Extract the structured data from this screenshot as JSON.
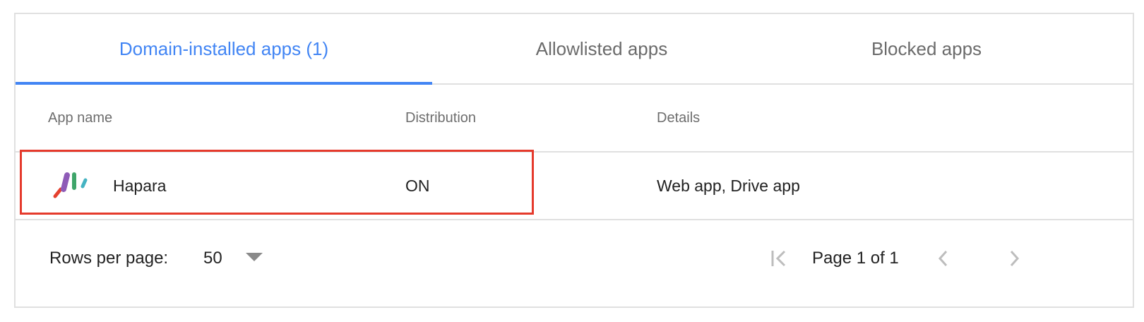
{
  "tabs": [
    {
      "label": "Domain-installed apps (1)",
      "active": true
    },
    {
      "label": "Allowlisted apps",
      "active": false
    },
    {
      "label": "Blocked apps",
      "active": false
    }
  ],
  "table": {
    "columns": [
      "App name",
      "Distribution",
      "Details"
    ],
    "rows": [
      {
        "app_name": "Hapara",
        "distribution": "ON",
        "details": "Web app, Drive app",
        "icon": "hapara-logo-icon"
      }
    ]
  },
  "pagination": {
    "rows_per_page_label": "Rows per page:",
    "rows_per_page_value": "50",
    "page_label": "Page 1 of 1"
  },
  "colors": {
    "accent": "#4285f4",
    "highlight": "#e53a2c",
    "border": "#e0e0e0"
  }
}
